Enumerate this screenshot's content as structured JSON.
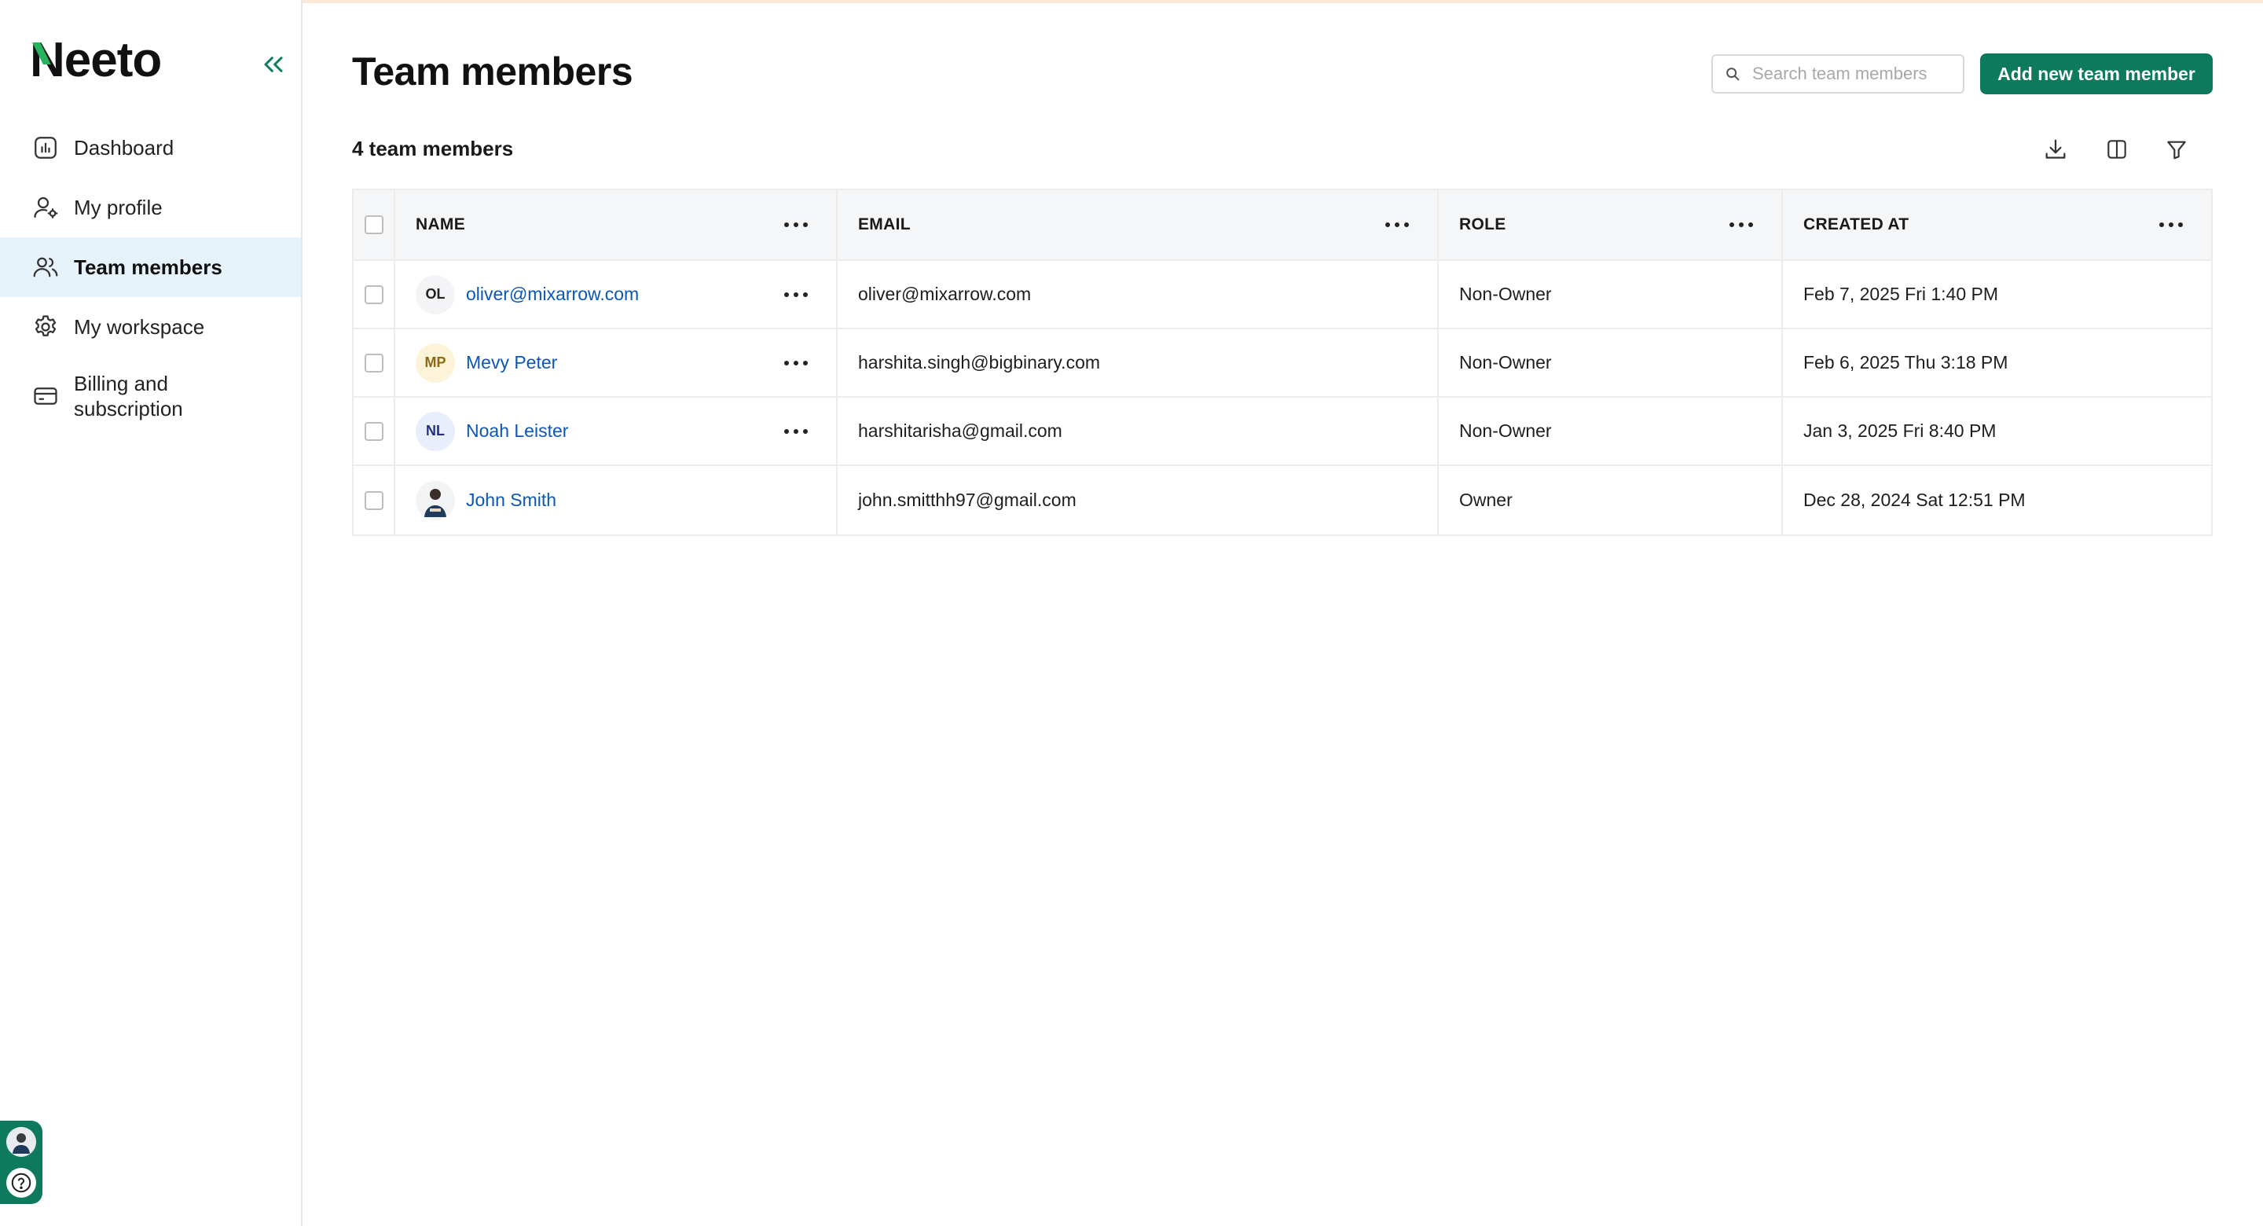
{
  "app": {
    "logo_text": "Neeto"
  },
  "sidebar": {
    "items": [
      {
        "label": "Dashboard",
        "icon": "chart-icon",
        "active": false
      },
      {
        "label": "My profile",
        "icon": "user-gear-icon",
        "active": false
      },
      {
        "label": "Team members",
        "icon": "team-icon",
        "active": true
      },
      {
        "label": "My workspace",
        "icon": "gear-icon",
        "active": false
      },
      {
        "label": "Billing and subscription",
        "label_line1": "Billing and",
        "label_line2": "subscription",
        "icon": "card-icon",
        "active": false
      }
    ]
  },
  "header": {
    "title": "Team members",
    "search_placeholder": "Search team members",
    "add_button": "Add new team member",
    "member_count_label": "4 team members"
  },
  "table": {
    "columns": [
      "NAME",
      "EMAIL",
      "ROLE",
      "CREATED AT"
    ],
    "rows": [
      {
        "initials": "OL",
        "name": "oliver@mixarrow.com",
        "email": "oliver@mixarrow.com",
        "role": "Non-Owner",
        "created_at": "Feb 7, 2025 Fri 1:40 PM",
        "has_menu": true
      },
      {
        "initials": "MP",
        "name": "Mevy Peter",
        "email": "harshita.singh@bigbinary.com",
        "role": "Non-Owner",
        "created_at": "Feb 6, 2025 Thu 3:18 PM",
        "has_menu": true
      },
      {
        "initials": "NL",
        "name": "Noah Leister",
        "email": "harshitarisha@gmail.com",
        "role": "Non-Owner",
        "created_at": "Jan 3, 2025 Fri 8:40 PM",
        "has_menu": true
      },
      {
        "initials": "",
        "name": "John Smith",
        "email": "john.smitthh97@gmail.com",
        "role": "Owner",
        "created_at": "Dec 28, 2024 Sat 12:51 PM",
        "has_menu": false
      }
    ]
  },
  "colors": {
    "brand": "#0e7a5d",
    "link": "#0b57b8",
    "active_nav": "#e7f3fb"
  }
}
